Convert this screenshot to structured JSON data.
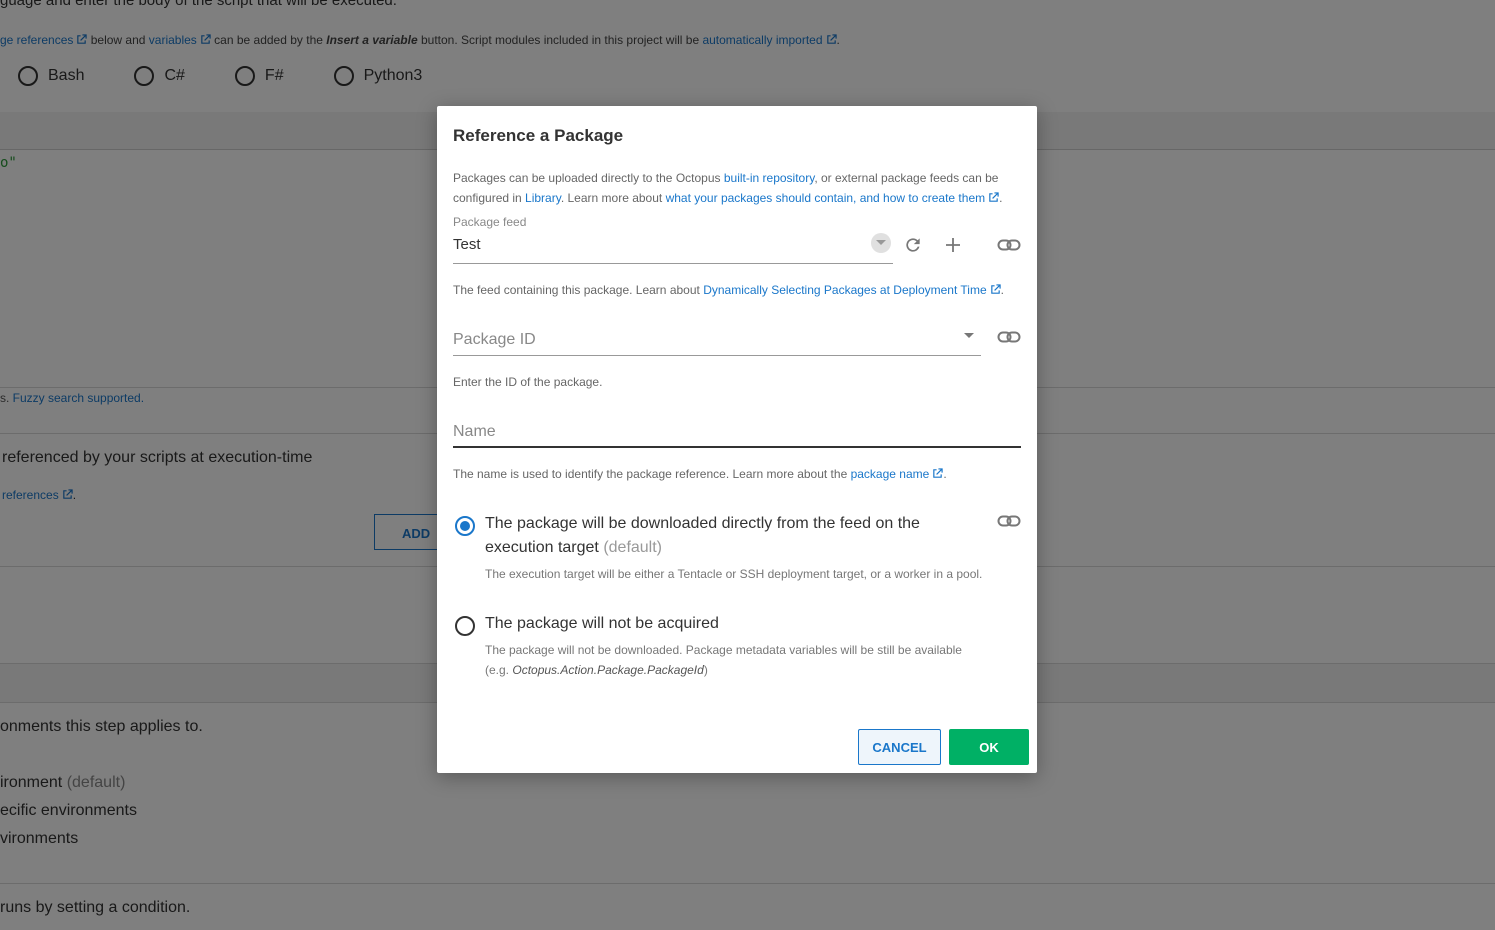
{
  "background": {
    "line1": "guage and enter the body of the script that will be executed.",
    "line2_prefix_link": "ge references",
    "line2_text1": " below and ",
    "line2_link2": "variables",
    "line2_text2": " can be added by the ",
    "line2_bold": "Insert a variable",
    "line2_text3": " button. Script modules included in this project will be ",
    "line2_link3": "automatically imported",
    "line2_end": ".",
    "languages": [
      "Bash",
      "C#",
      "F#",
      "Python3"
    ],
    "code_fragment": "o\"",
    "fuzzy_prefix": "s. ",
    "fuzzy_link": "Fuzzy search supported.",
    "referenced_text": "referenced by your scripts at execution-time",
    "references_link": "references",
    "references_end": ".",
    "add_button": "ADD",
    "env_intro": "onments this step applies to.",
    "env_option1": "ironment",
    "env_option1_default": "(default)",
    "env_option2": "ecific environments",
    "env_option3": "vironments",
    "condition_text": "runs by setting a condition."
  },
  "dialog": {
    "title": "Reference a Package",
    "intro_text1": "Packages can be uploaded directly to the Octopus ",
    "intro_link1": "built-in repository",
    "intro_text2": ", or external package feeds can be configured in ",
    "intro_link2": "Library",
    "intro_text3": ". Learn more about ",
    "intro_link3": "what your packages should contain, and how to create them",
    "intro_end": ".",
    "feed_label": "Package feed",
    "feed_value": "Test",
    "feed_help_text": "The feed containing this package. Learn about ",
    "feed_help_link": "Dynamically Selecting Packages at Deployment Time",
    "feed_help_end": ".",
    "package_id_placeholder": "Package ID",
    "package_id_help": "Enter the ID of the package.",
    "name_placeholder": "Name",
    "name_help_text": "The name is used to identify the package reference. Learn more about the ",
    "name_help_link": "package name",
    "name_help_end": ".",
    "option1_label": "The package will be downloaded directly from the feed on the execution target",
    "option1_default": "(default)",
    "option1_help": "The execution target will be either a Tentacle or SSH deployment target, or a worker in a pool.",
    "option2_label": "The package will not be acquired",
    "option2_help_text": "The package will not be downloaded. Package metadata variables will be still be available (e.g. ",
    "option2_help_code": "Octopus.Action.Package.PackageId",
    "option2_help_end": ")",
    "cancel_label": "CANCEL",
    "ok_label": "OK"
  },
  "colors": {
    "link": "#1a77ca",
    "ok_button": "#00b065",
    "overlay": "rgba(0,0,0,0.5)"
  }
}
